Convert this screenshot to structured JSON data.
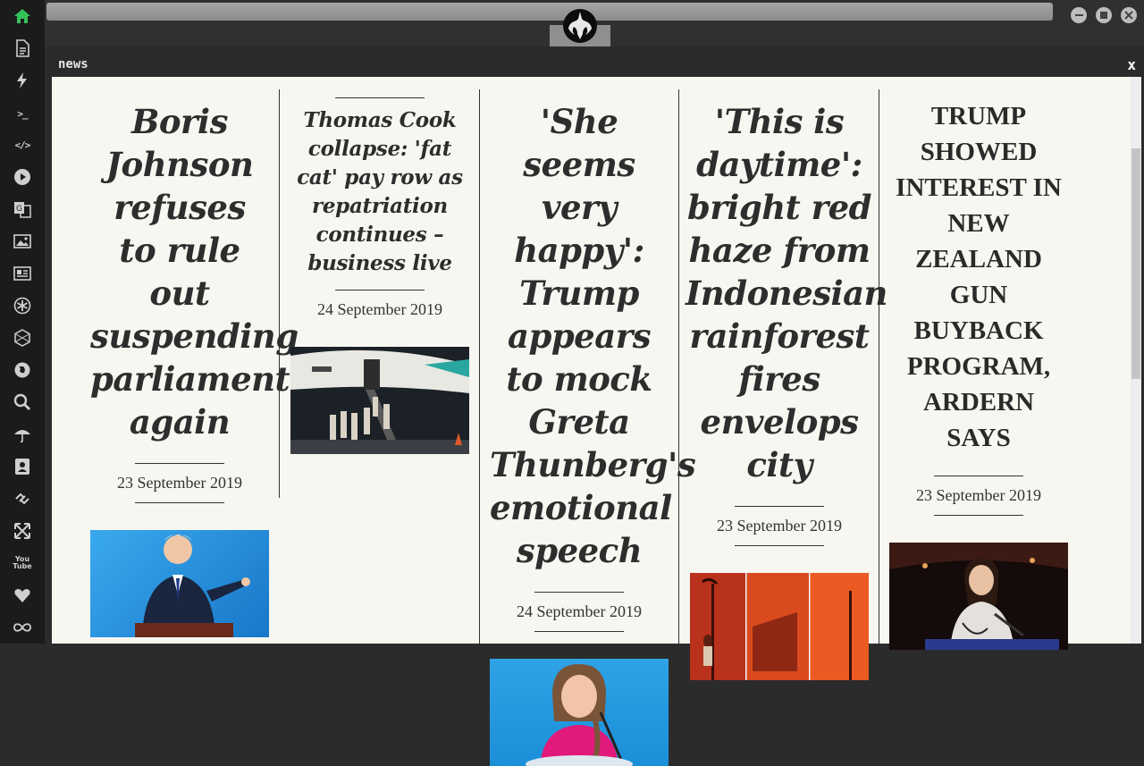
{
  "dock": {
    "items": [
      {
        "name": "home-icon"
      },
      {
        "name": "document-icon"
      },
      {
        "name": "lightning-icon"
      },
      {
        "name": "terminal-icon",
        "label": ">_"
      },
      {
        "name": "code-icon",
        "label": "</>"
      },
      {
        "name": "play-icon"
      },
      {
        "name": "translate-icon"
      },
      {
        "name": "image-icon"
      },
      {
        "name": "news-icon"
      },
      {
        "name": "settings-cog-icon"
      },
      {
        "name": "hexagon-icon"
      },
      {
        "name": "globe-icon"
      },
      {
        "name": "search-icon"
      },
      {
        "name": "umbrella-icon"
      },
      {
        "name": "contact-card-icon"
      },
      {
        "name": "link-icon"
      },
      {
        "name": "expand-icon"
      },
      {
        "name": "youtube-icon",
        "label": "You Tube"
      },
      {
        "name": "heart-icon"
      },
      {
        "name": "infinity-icon"
      }
    ],
    "accent": "#33c25a"
  },
  "window": {
    "title": "news",
    "close_label": "x"
  },
  "articles": [
    {
      "headline": "Boris Johnson refuses to rule out suspending parliament again",
      "date": "23 September 2019",
      "style": "big"
    },
    {
      "headline": "Thomas Cook collapse: 'fat cat' pay row as repatriation continues – business live",
      "date": "24 September 2019",
      "style": "small"
    },
    {
      "headline": "'She seems very happy': Trump appears to mock Greta Thunberg's emotional speech",
      "date": "24 September 2019",
      "style": "big"
    },
    {
      "headline": "'This is daytime': bright red haze from Indonesian rainforest fires envelops city",
      "date": "23 September 2019",
      "style": "big"
    },
    {
      "headline": "TRUMP SHOWED INTEREST IN NEW ZEALAND GUN BUYBACK PROGRAM, ARDERN SAYS",
      "date": "23 September 2019",
      "style": "caps"
    }
  ]
}
